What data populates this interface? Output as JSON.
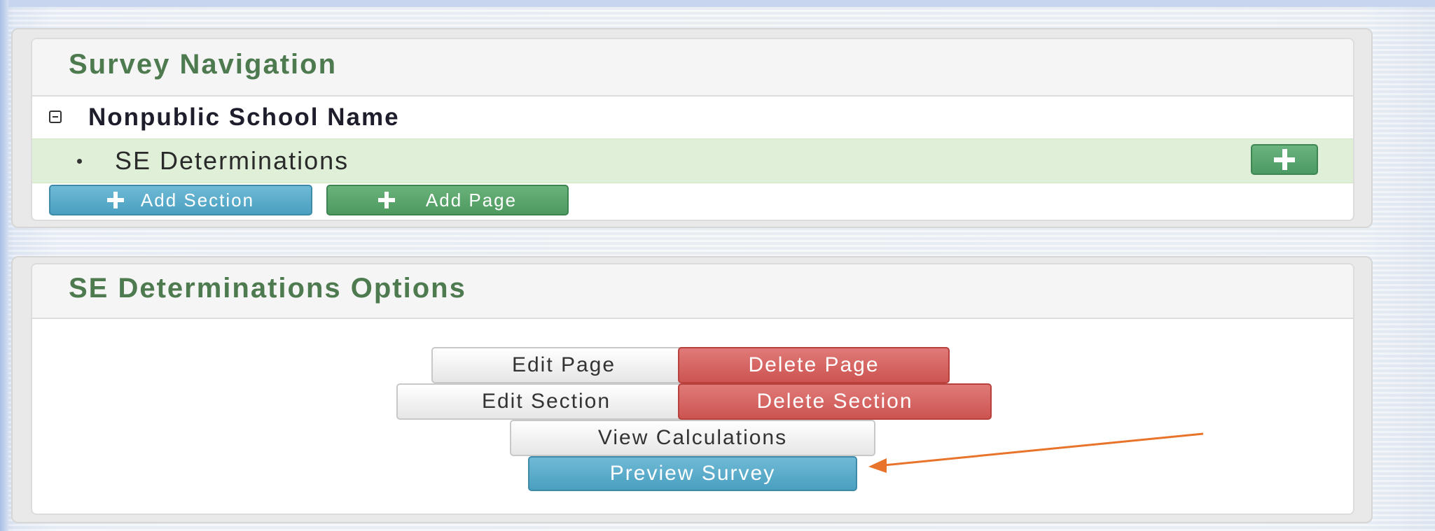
{
  "navigation_panel": {
    "title": "Survey Navigation",
    "tree": {
      "root_label": "Nonpublic School Name",
      "items": [
        {
          "label": "SE Determinations"
        }
      ]
    },
    "add_section_label": "Add Section",
    "add_page_label": "Add Page"
  },
  "options_panel": {
    "title": "SE Determinations Options",
    "edit_page_label": "Edit Page",
    "delete_page_label": "Delete Page",
    "edit_section_label": "Edit Section",
    "delete_section_label": "Delete Section",
    "view_calculations_label": "View Calculations",
    "preview_survey_label": "Preview Survey"
  },
  "colors": {
    "title_text": "#4e7a4f",
    "info_button": "#5aacca",
    "success_button": "#5ca86e",
    "danger_button": "#d8625f",
    "selected_row": "#dfefd8",
    "annotation_arrow": "#e8742c"
  },
  "icons": {
    "collapse": "minus-square-icon",
    "bullet": "bullet-icon",
    "add": "plus-icon",
    "annotation": "arrow-icon"
  }
}
